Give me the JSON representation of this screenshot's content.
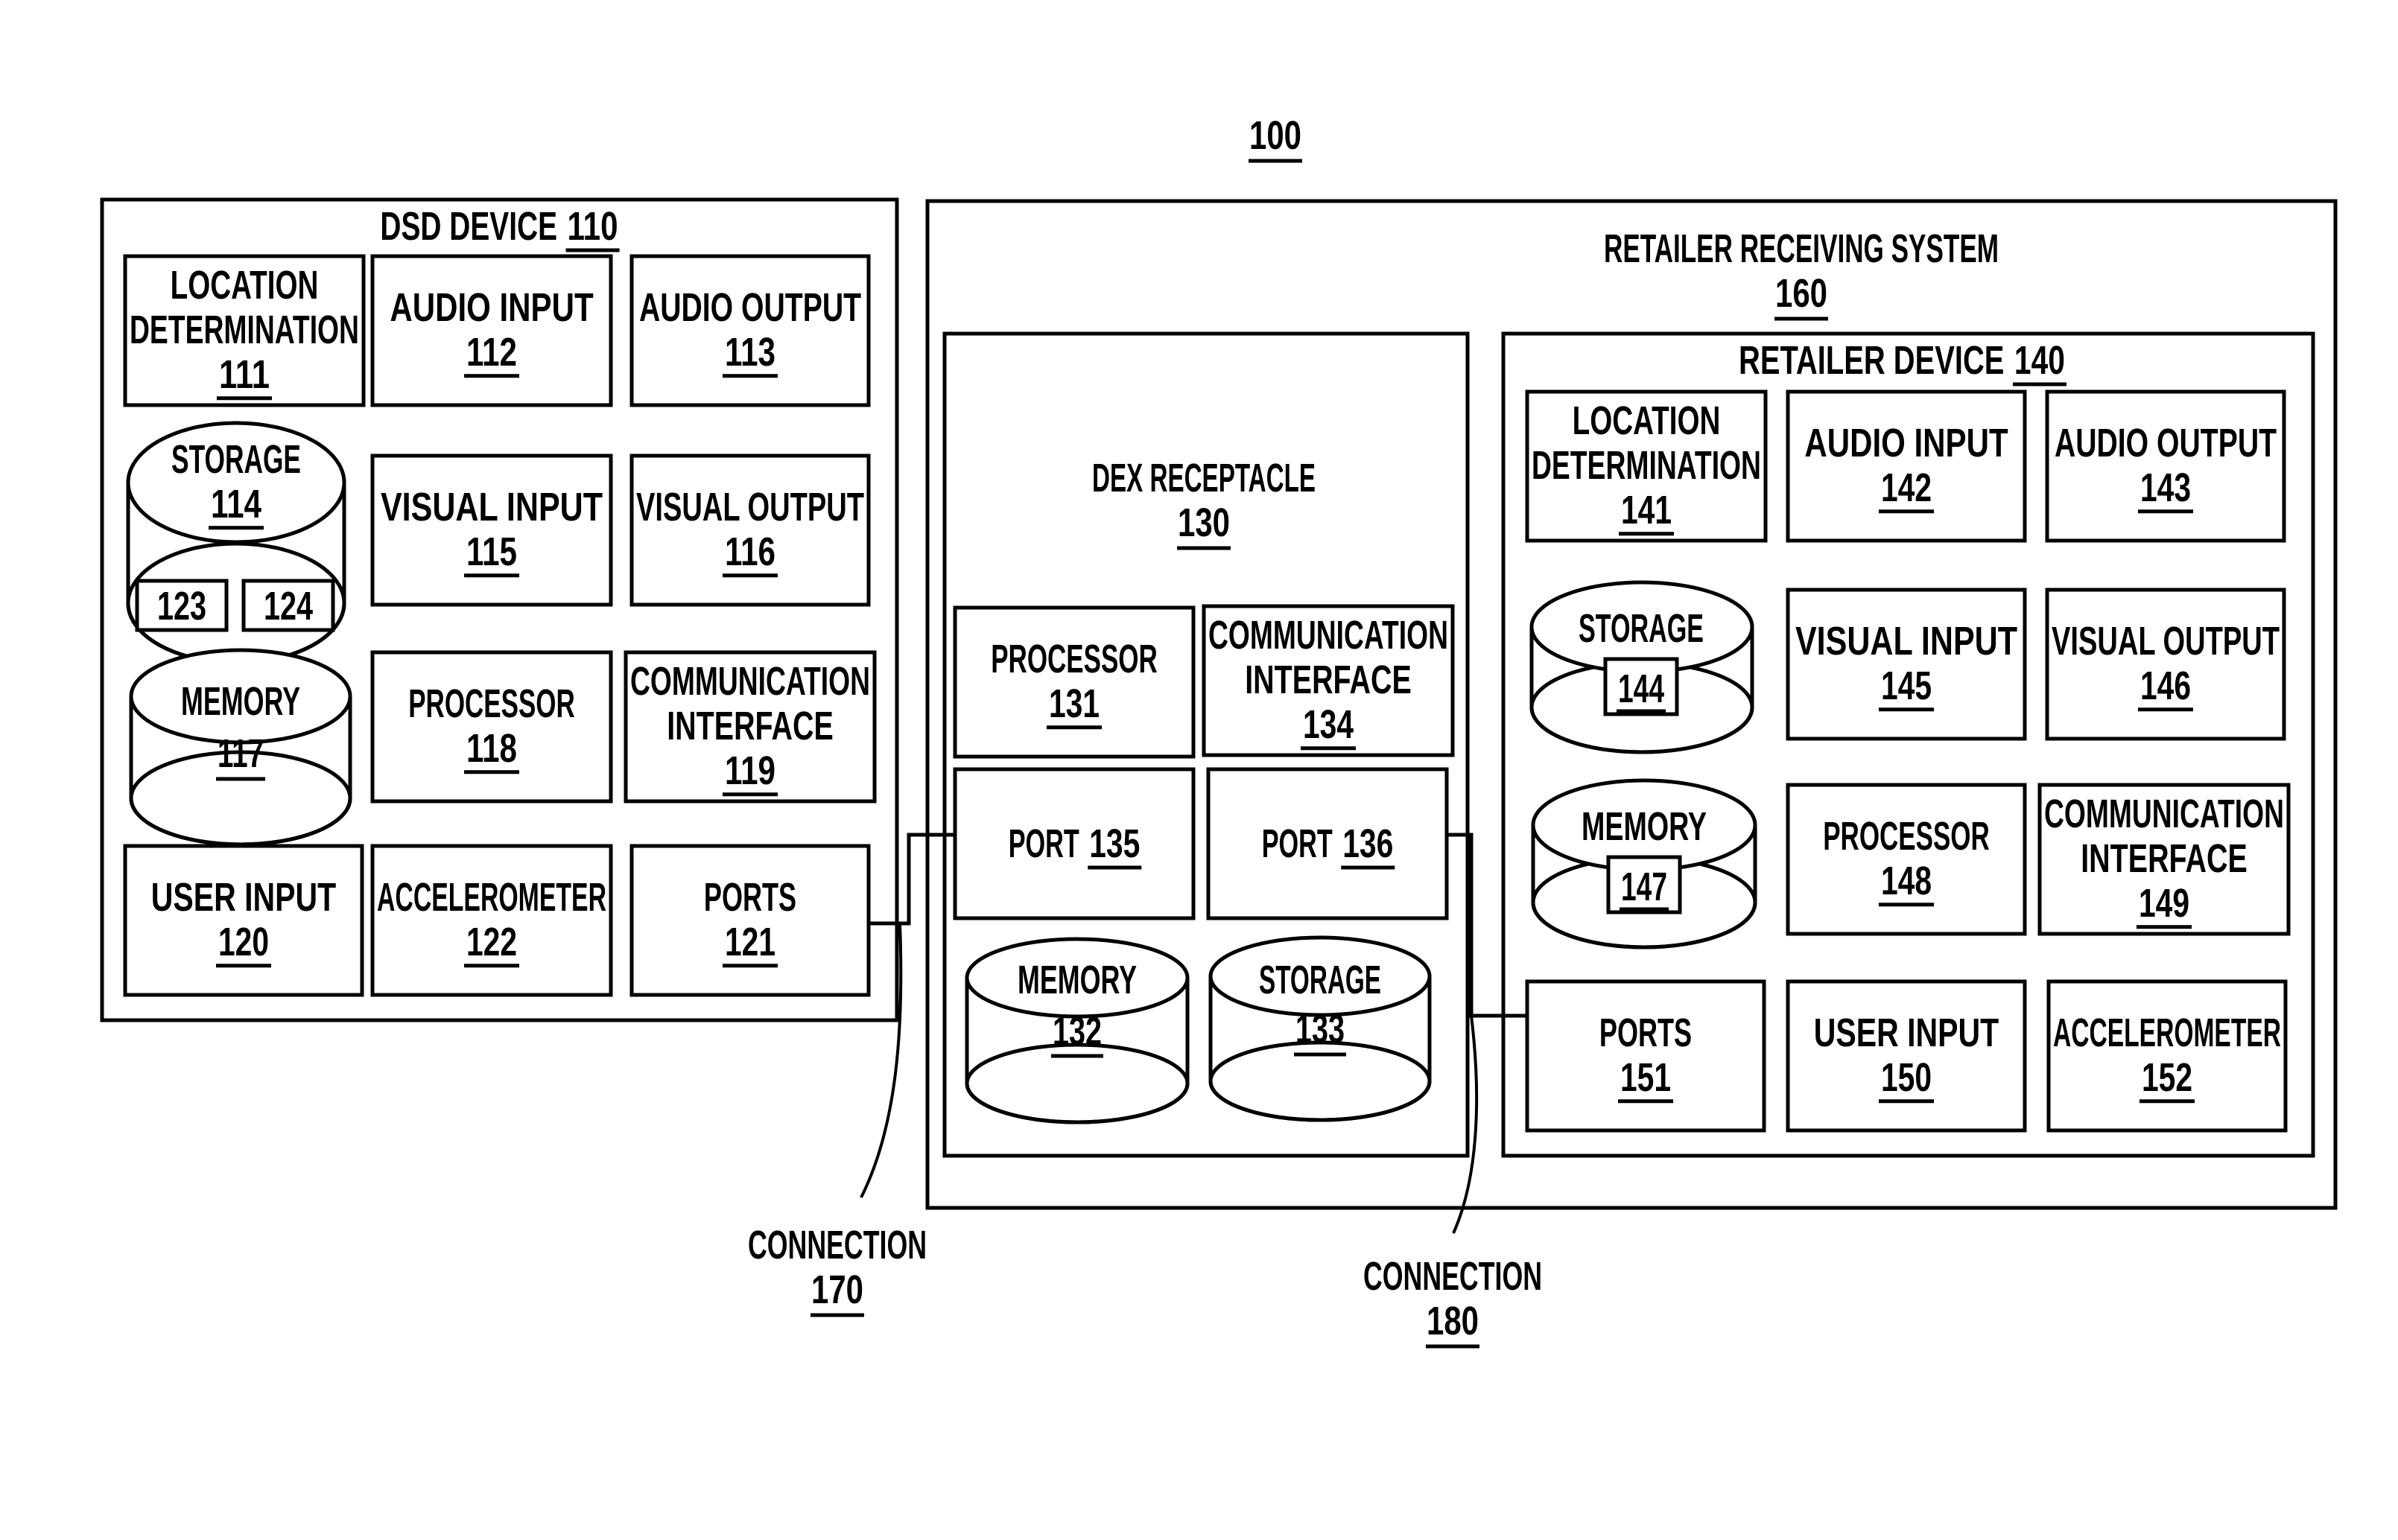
{
  "figure_ref": "100",
  "dsd_device": {
    "title": "DSD DEVICE",
    "ref": "110",
    "components": [
      {
        "id": "location",
        "lines": [
          "LOCATION",
          "DETERMINATION"
        ],
        "ref": "111",
        "shape": "box"
      },
      {
        "id": "audio-input",
        "lines": [
          "AUDIO INPUT"
        ],
        "ref": "112",
        "shape": "box"
      },
      {
        "id": "audio-output",
        "lines": [
          "AUDIO OUTPUT"
        ],
        "ref": "113",
        "shape": "box"
      },
      {
        "id": "storage",
        "lines": [
          "STORAGE"
        ],
        "ref": "114",
        "shape": "cylinder",
        "sub_refs": [
          "123",
          "124"
        ]
      },
      {
        "id": "visual-input",
        "lines": [
          "VISUAL INPUT"
        ],
        "ref": "115",
        "shape": "box"
      },
      {
        "id": "visual-output",
        "lines": [
          "VISUAL OUTPUT"
        ],
        "ref": "116",
        "shape": "box"
      },
      {
        "id": "memory",
        "lines": [
          "MEMORY"
        ],
        "ref": "117",
        "shape": "cylinder"
      },
      {
        "id": "processor",
        "lines": [
          "PROCESSOR"
        ],
        "ref": "118",
        "shape": "box"
      },
      {
        "id": "communication-interface",
        "lines": [
          "COMMUNICATION",
          "INTERFACE"
        ],
        "ref": "119",
        "shape": "box"
      },
      {
        "id": "user-input",
        "lines": [
          "USER INPUT"
        ],
        "ref": "120",
        "shape": "box"
      },
      {
        "id": "accelerometer",
        "lines": [
          "ACCELEROMETER"
        ],
        "ref": "122",
        "shape": "box"
      },
      {
        "id": "ports",
        "lines": [
          "PORTS"
        ],
        "ref": "121",
        "shape": "box"
      }
    ]
  },
  "retailer_receiving_system": {
    "title": "RETAILER RECEIVING SYSTEM",
    "ref": "160",
    "dex_receptacle": {
      "title": "DEX RECEPTACLE",
      "ref": "130",
      "components": [
        {
          "id": "processor",
          "lines": [
            "PROCESSOR"
          ],
          "ref": "131",
          "shape": "box"
        },
        {
          "id": "communication-interface",
          "lines": [
            "COMMUNICATION",
            "INTERFACE"
          ],
          "ref": "134",
          "shape": "box"
        },
        {
          "id": "port-135",
          "lines": [
            "PORT"
          ],
          "ref": "135",
          "shape": "box",
          "inline": true
        },
        {
          "id": "port-136",
          "lines": [
            "PORT"
          ],
          "ref": "136",
          "shape": "box",
          "inline": true
        },
        {
          "id": "memory",
          "lines": [
            "MEMORY"
          ],
          "ref": "132",
          "shape": "cylinder"
        },
        {
          "id": "storage",
          "lines": [
            "STORAGE"
          ],
          "ref": "133",
          "shape": "cylinder"
        }
      ]
    },
    "retailer_device": {
      "title": "RETAILER DEVICE",
      "ref": "140",
      "components": [
        {
          "id": "location",
          "lines": [
            "LOCATION",
            "DETERMINATION"
          ],
          "ref": "141",
          "shape": "box"
        },
        {
          "id": "audio-input",
          "lines": [
            "AUDIO INPUT"
          ],
          "ref": "142",
          "shape": "box"
        },
        {
          "id": "audio-output",
          "lines": [
            "AUDIO OUTPUT"
          ],
          "ref": "143",
          "shape": "box"
        },
        {
          "id": "storage",
          "lines": [
            "STORAGE"
          ],
          "ref": "144",
          "shape": "cylinder",
          "boxed_ref": true
        },
        {
          "id": "visual-input",
          "lines": [
            "VISUAL INPUT"
          ],
          "ref": "145",
          "shape": "box"
        },
        {
          "id": "visual-output",
          "lines": [
            "VISUAL OUTPUT"
          ],
          "ref": "146",
          "shape": "box"
        },
        {
          "id": "memory",
          "lines": [
            "MEMORY"
          ],
          "ref": "147",
          "shape": "cylinder",
          "boxed_ref": true
        },
        {
          "id": "processor",
          "lines": [
            "PROCESSOR"
          ],
          "ref": "148",
          "shape": "box"
        },
        {
          "id": "communication-interface",
          "lines": [
            "COMMUNICATION",
            "INTERFACE"
          ],
          "ref": "149",
          "shape": "box"
        },
        {
          "id": "ports",
          "lines": [
            "PORTS"
          ],
          "ref": "151",
          "shape": "box"
        },
        {
          "id": "user-input",
          "lines": [
            "USER INPUT"
          ],
          "ref": "150",
          "shape": "box"
        },
        {
          "id": "accelerometer",
          "lines": [
            "ACCELEROMETER"
          ],
          "ref": "152",
          "shape": "box"
        }
      ]
    }
  },
  "connections": [
    {
      "label": "CONNECTION",
      "ref": "170",
      "from": "PORTS 121",
      "to": "PORT 135"
    },
    {
      "label": "CONNECTION",
      "ref": "180",
      "from": "PORT 136",
      "to": "PORTS 151"
    }
  ]
}
